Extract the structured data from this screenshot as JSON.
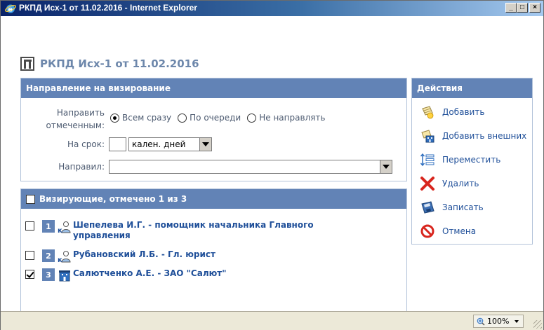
{
  "window": {
    "title": "РКПД Исх-1 от 11.02.2016 - Internet Explorer",
    "minimize_label": "_",
    "maximize_label": "□",
    "close_label": "×"
  },
  "document": {
    "title": "РКПД Исх-1 от 11.02.2016"
  },
  "route_panel": {
    "header": "Направление на визирование",
    "send_label_line1": "Направить",
    "send_label_line2": "отмеченным:",
    "options": [
      {
        "label": "Всем сразу",
        "checked": true
      },
      {
        "label": "По очереди",
        "checked": false
      },
      {
        "label": "Не направлять",
        "checked": false
      }
    ],
    "term_label": "На срок:",
    "term_value": "",
    "term_unit": "кален. дней",
    "sender_label": "Направил:",
    "sender_value": ""
  },
  "signers_panel": {
    "header": "Визирующие, отмечено 1 из 3",
    "header_checked": false,
    "items": [
      {
        "num": "1",
        "name_line1": "Шепелева И.Г. - помощник начальника Главного",
        "name_line2": "управления",
        "checked": false,
        "icon": "person-icon"
      },
      {
        "num": "2",
        "name_line1": "Рубановский Л.Б. - Гл. юрист",
        "name_line2": "",
        "checked": false,
        "icon": "person-icon"
      },
      {
        "num": "3",
        "name_line1": "Салютченко А.Е. - ЗАО \"Салют\"",
        "name_line2": "",
        "checked": true,
        "icon": "organization-icon"
      }
    ]
  },
  "actions_panel": {
    "header": "Действия",
    "items": [
      {
        "label": "Добавить",
        "icon": "add-icon"
      },
      {
        "label": "Добавить внешних",
        "icon": "add-external-icon"
      },
      {
        "label": "Переместить",
        "icon": "move-icon"
      },
      {
        "label": "Удалить",
        "icon": "delete-icon"
      },
      {
        "label": "Записать",
        "icon": "save-icon"
      },
      {
        "label": "Отмена",
        "icon": "cancel-icon"
      }
    ]
  },
  "statusbar": {
    "zoom": "100%"
  },
  "colors": {
    "panel_header": "#6283b6",
    "link_text": "#1f4f99",
    "doc_title": "#6d87ab"
  }
}
